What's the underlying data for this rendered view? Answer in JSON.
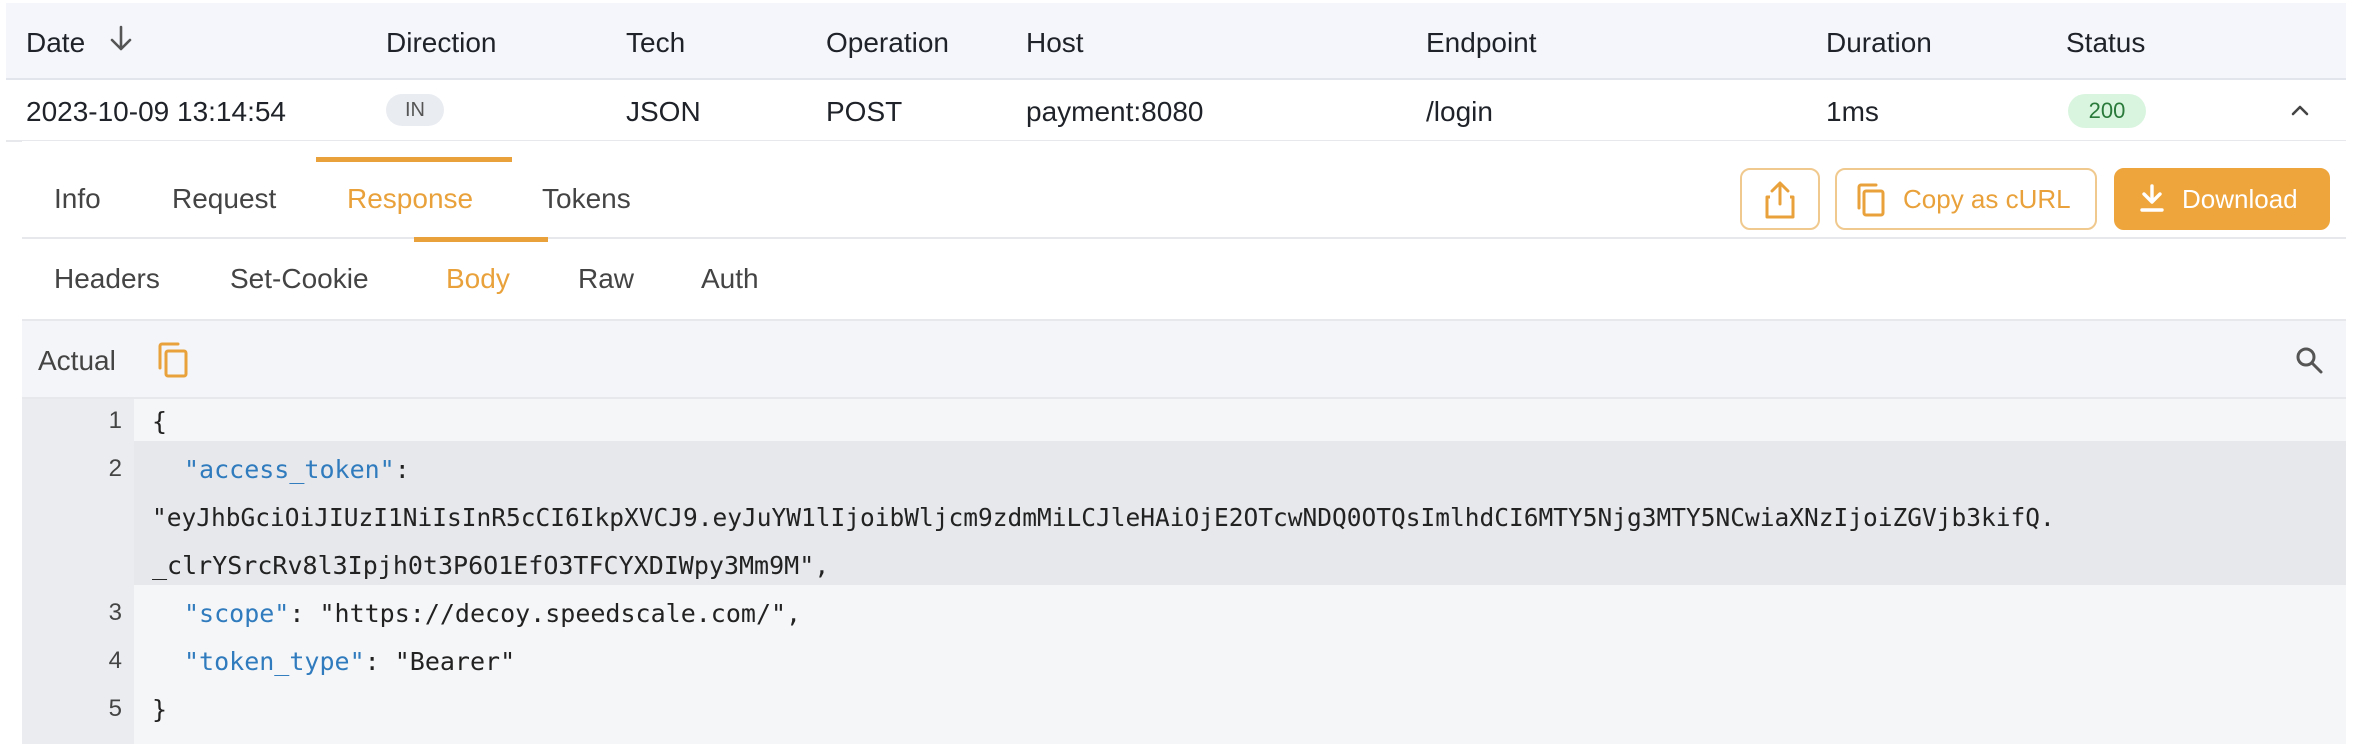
{
  "table": {
    "headers": {
      "date": "Date",
      "direction": "Direction",
      "tech": "Tech",
      "operation": "Operation",
      "host": "Host",
      "endpoint": "Endpoint",
      "duration": "Duration",
      "status": "Status"
    },
    "row": {
      "date": "2023-10-09 13:14:54",
      "direction": "IN",
      "tech": "JSON",
      "operation": "POST",
      "host": "payment:8080",
      "endpoint": "/login",
      "duration": "1ms",
      "status": "200"
    }
  },
  "detail": {
    "tabs": [
      "Info",
      "Request",
      "Response",
      "Tokens"
    ],
    "active_tab": "Response",
    "actions": {
      "copy_label": "Copy as cURL",
      "download_label": "Download"
    },
    "subtabs": [
      "Headers",
      "Set-Cookie",
      "Body",
      "Raw",
      "Auth"
    ],
    "active_subtab": "Body",
    "body_label": "Actual"
  },
  "code": {
    "line_numbers": [
      "1",
      "2",
      "3",
      "4",
      "5"
    ],
    "line1": "{",
    "line2_key": "\"access_token\"",
    "line2_colon": ":",
    "line2_value_a": "\"eyJhbGciOiJIUzI1NiIsInR5cCI6IkpXVCJ9.eyJuYW1lIjoibWljcm9zdmMiLCJleHAiOjE2OTcwNDQ0OTQsImlhdCI6MTY5Njg3MTY5NCwiaXNzIjoiZGVjb3kifQ.",
    "line2_value_b": "_clrYSrcRv8l3Ipjh0t3P6O1EfO3TFCYXDIWpy3Mm9M\",",
    "line3_key": "\"scope\"",
    "line3_rest": ": \"https://decoy.speedscale.com/\",",
    "line4_key": "\"token_type\"",
    "line4_rest": ": \"Bearer\"",
    "line5": "}"
  },
  "colors": {
    "accent": "#e9a23b",
    "status_ok_bg": "#d9f5df",
    "json_key": "#2f7bbd"
  }
}
